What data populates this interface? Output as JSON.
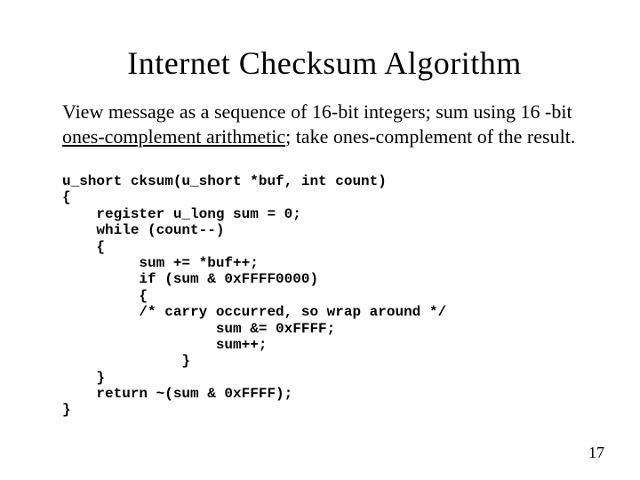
{
  "title": "Internet Checksum Algorithm",
  "desc_pre": "View message as a sequence of 16-bit integers; sum using 16 -bit ",
  "desc_u": "ones-complement arithmetic",
  "desc_post": "; take ones-complement of the result.",
  "code": "u_short cksum(u_short *buf, int count)\n{\n    register u_long sum = 0;\n    while (count--)\n    {\n         sum += *buf++;\n         if (sum & 0xFFFF0000)\n         {\n         /* carry occurred, so wrap around */\n                  sum &= 0xFFFF;\n                  sum++;\n              }\n    }\n    return ~(sum & 0xFFFF);\n}",
  "page_number": "17"
}
